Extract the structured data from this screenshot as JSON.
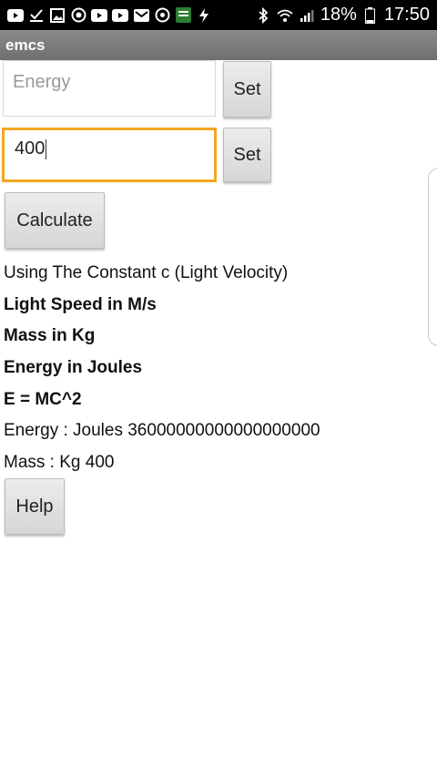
{
  "status_bar": {
    "icons": [
      "youtube-icon",
      "download-done-icon",
      "image-icon",
      "whatsapp-icon",
      "youtube-icon",
      "youtube-icon",
      "gmail-icon",
      "sync-icon",
      "app-icon",
      "flash-icon"
    ],
    "right_icons": [
      "bluetooth-icon",
      "wifi-icon",
      "signal-icon",
      "battery-icon"
    ],
    "battery": "18%",
    "time": "17:50"
  },
  "app": {
    "title": "emcs"
  },
  "inputs": {
    "energy_placeholder": "Energy",
    "mass_value": "400"
  },
  "buttons": {
    "set_energy": "Set",
    "set_mass": "Set",
    "calculate": "Calculate",
    "help": "Help"
  },
  "info": {
    "line1": "Using The Constant c (Light Velocity)",
    "line2": "Light Speed in M/s",
    "line3": "Mass in Kg",
    "line4": "Energy in Joules",
    "line5": "E = MC^2",
    "line6": "Energy : Joules 36000000000000000000",
    "line7": "Mass : Kg 400"
  },
  "colors": {
    "status_bar_bg": "#000000",
    "title_bar_bg": "#7a7a7a",
    "focus_border": "#f5a623",
    "button_bg": "#e0e0e0"
  }
}
